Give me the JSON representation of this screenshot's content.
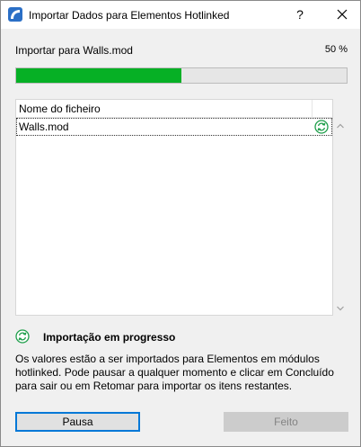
{
  "window": {
    "title": "Importar Dados para Elementos Hotlinked",
    "help_label": "?"
  },
  "progress": {
    "label": "Importar para Walls.mod",
    "percent_text": "50 %",
    "fraction": 0.5,
    "fill_color": "#06b025"
  },
  "file_list": {
    "column_header": "Nome do ficheiro",
    "rows": [
      {
        "name": "Walls.mod",
        "status_icon": "in-progress-icon"
      }
    ]
  },
  "status": {
    "icon": "in-progress-icon",
    "title": "Importação em progresso",
    "description": "Os valores estão a ser importados para Elementos em módulos hotlinked. Pode pausar a qualquer momento e clicar em Concluído para sair ou em Retomar para importar os itens restantes."
  },
  "buttons": {
    "pause_label": "Pausa",
    "done_label": "Feito"
  },
  "colors": {
    "accent": "#0078d7",
    "progress": "#06b025",
    "status_icon": "#1e9e4a"
  }
}
